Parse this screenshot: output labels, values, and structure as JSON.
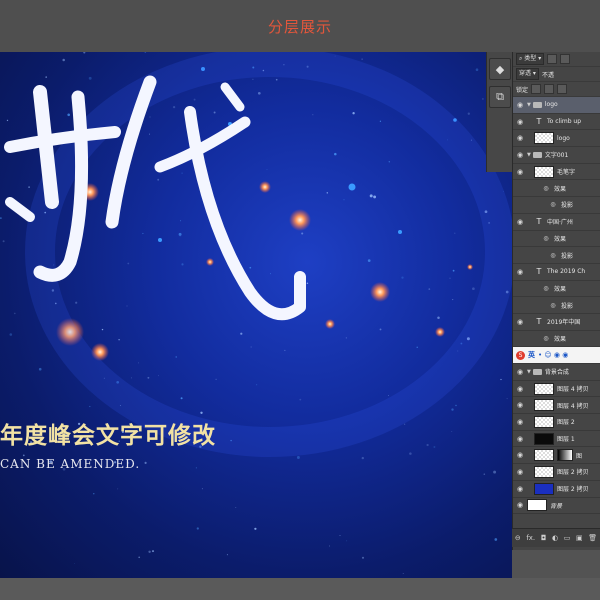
{
  "header": {
    "title": "分层展示"
  },
  "canvas": {
    "calligraphy_glyphs": "时代",
    "subtitle": "年度峰会文字可修改",
    "tagline": "CAN BE AMENDED."
  },
  "tools": [
    {
      "icon": "3d-rotate-icon",
      "glyph": "◆"
    },
    {
      "icon": "history-icon",
      "glyph": "⧉"
    }
  ],
  "layers_panel": {
    "kind_filter": "类型",
    "blend_mode": "穿透",
    "opacity_label": "不透",
    "lock_label": "锁定",
    "ime": {
      "logo": "S",
      "mode": "英",
      "dots": "• ☺ ◉ ◉"
    },
    "layers": [
      {
        "type": "group",
        "name": "logo",
        "indent": 0,
        "selected": true
      },
      {
        "type": "text",
        "name": "To climb up",
        "indent": 1
      },
      {
        "type": "pixel",
        "name": "logo",
        "indent": 1,
        "thumb": "checker"
      },
      {
        "type": "group",
        "name": "文字001",
        "indent": 0
      },
      {
        "type": "pixel",
        "name": "毛笔字",
        "indent": 1,
        "thumb": "checker"
      },
      {
        "type": "effect",
        "name": "效果",
        "indent": 2
      },
      {
        "type": "effect",
        "name": "投影",
        "indent": 3
      },
      {
        "type": "text",
        "name": "中国·广州",
        "indent": 1
      },
      {
        "type": "effect",
        "name": "效果",
        "indent": 2
      },
      {
        "type": "effect",
        "name": "投影",
        "indent": 3
      },
      {
        "type": "text",
        "name": "The 2019 Ch",
        "indent": 1
      },
      {
        "type": "effect",
        "name": "效果",
        "indent": 2
      },
      {
        "type": "effect",
        "name": "投影",
        "indent": 3
      },
      {
        "type": "text",
        "name": "2019年中国",
        "indent": 1
      },
      {
        "type": "effect",
        "name": "效果",
        "indent": 2
      },
      {
        "type": "ime",
        "name": ""
      },
      {
        "type": "group",
        "name": "背景合成",
        "indent": 0
      },
      {
        "type": "pixel",
        "name": "图层 4 拷贝",
        "indent": 1,
        "thumb": "checker"
      },
      {
        "type": "pixel",
        "name": "图层 4 拷贝",
        "indent": 1,
        "thumb": "checker"
      },
      {
        "type": "pixel",
        "name": "图层 2",
        "indent": 1,
        "thumb": "checker"
      },
      {
        "type": "pixel",
        "name": "图层 1",
        "indent": 1,
        "thumb": "blk"
      },
      {
        "type": "masked",
        "name": "图",
        "indent": 1,
        "thumb": "checker"
      },
      {
        "type": "pixel",
        "name": "图层 2 拷贝",
        "indent": 1,
        "thumb": "checker"
      },
      {
        "type": "pixel",
        "name": "图层 2 拷贝",
        "indent": 1,
        "thumb": "blue"
      },
      {
        "type": "pixel",
        "name": "背景",
        "indent": 0,
        "thumb": "wht"
      }
    ],
    "footer": [
      "⊖",
      "fx.",
      "◘",
      "◐",
      "▭",
      "▣",
      "🗑"
    ]
  },
  "colors": {
    "title_text": "#e2563b",
    "subtitle_text": "#f2e2a4",
    "canvas_blue": "#122c9e",
    "highlight_row": "#5a5f6c"
  }
}
